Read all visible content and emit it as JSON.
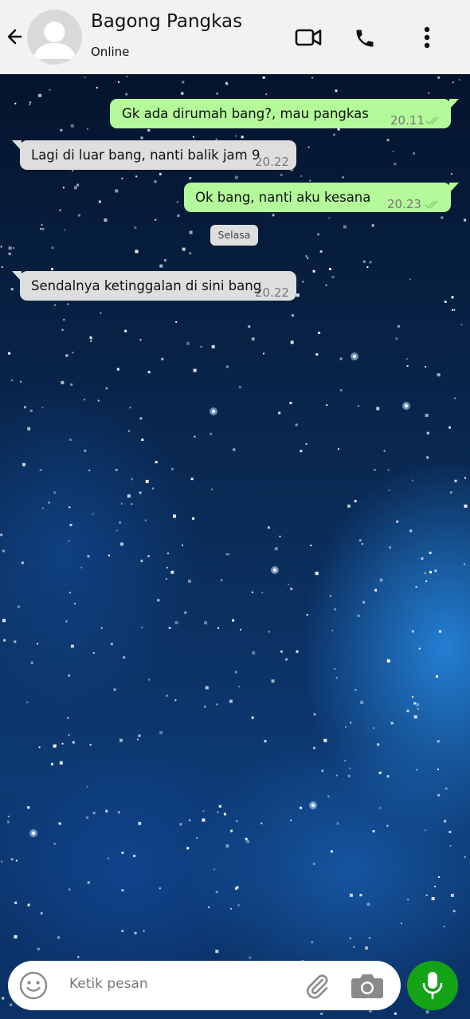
{
  "header": {
    "contact_name": "Bagong Pangkas",
    "status": "Online",
    "icons": [
      "back-arrow-icon",
      "video-call-icon",
      "phone-icon",
      "more-vert-icon"
    ]
  },
  "messages": [
    {
      "direction": "outgoing",
      "text": "Gk ada dirumah bang?, mau pangkas",
      "time": "20.11",
      "read": true
    },
    {
      "direction": "incoming",
      "text": "Lagi di luar bang, nanti balik jam 9",
      "time": "20.22"
    },
    {
      "direction": "outgoing",
      "text": "Ok bang, nanti aku kesana",
      "time": "20.23",
      "read": true
    },
    {
      "direction": "incoming",
      "text": "Sendalnya ketinggalan di sini bang",
      "time": "20.22"
    }
  ],
  "date_separator": "Selasa",
  "composer": {
    "placeholder": "Ketik pesan",
    "icons": [
      "emoji-icon",
      "attach-icon",
      "camera-icon",
      "mic-icon"
    ]
  },
  "colors": {
    "header_bg": "#f2f2f2",
    "outgoing_bubble": "#b4f99a",
    "incoming_bubble": "#dedede",
    "mic_button": "#14a316",
    "read_ticks": "#7bd36a"
  }
}
